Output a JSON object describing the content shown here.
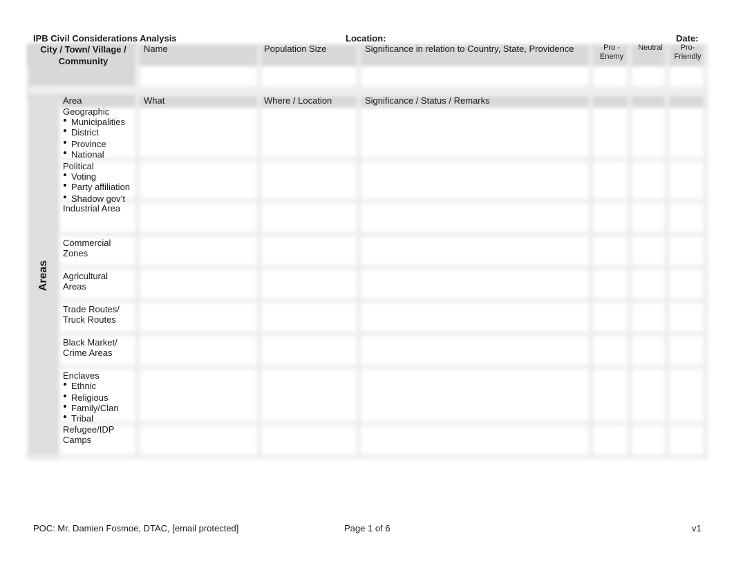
{
  "header": {
    "title": "IPB Civil Considerations Analysis",
    "location_label": "Location:",
    "date_label": "Date:"
  },
  "top_table": {
    "col1": "City / Town/ Village / Community",
    "col2": "Name",
    "col3": "Population Size",
    "col4": "Significance in relation to Country, State, Providence",
    "col5": "Pro - Enemy",
    "col6": "Neutral",
    "col7": "Pro- Friendly"
  },
  "areas_table": {
    "section_label": "Areas",
    "columns": {
      "area": "Area",
      "what": "What",
      "where": "Where / Location",
      "significance": "Significance / Status / Remarks"
    },
    "rows": [
      {
        "title": "Geographic",
        "bullets": [
          "Municipalities",
          "District",
          "Province",
          "National"
        ]
      },
      {
        "title": "Political",
        "bullets": [
          "Voting",
          "Party affiliation",
          "Shadow gov’t"
        ]
      },
      {
        "title": "Industrial Area",
        "bullets": []
      },
      {
        "title": "Commercial Zones",
        "line1": "Commercial",
        "line2": "Zones",
        "bullets": []
      },
      {
        "title": "Agricultural Areas",
        "line1": "Agricultural",
        "line2": "Areas",
        "bullets": []
      },
      {
        "title": "Trade Routes/ Truck Routes",
        "line1": "Trade Routes/",
        "line2": "Truck Routes",
        "bullets": []
      },
      {
        "title": "Black Market/ Crime Areas",
        "line1": "Black Market/",
        "line2": "Crime Areas",
        "bullets": []
      },
      {
        "title": "Enclaves",
        "bullets": [
          "Ethnic",
          "Religious",
          "Family/Clan",
          "Tribal"
        ]
      },
      {
        "title": "Refugee/IDP Camps",
        "line1": "Refugee/IDP",
        "line2": "Camps",
        "bullets": []
      }
    ]
  },
  "footer": {
    "poc": "POC: Mr. Damien Fosmoe, DTAC, [email protected]",
    "page": "Page 1 of 6",
    "version": "v1"
  }
}
